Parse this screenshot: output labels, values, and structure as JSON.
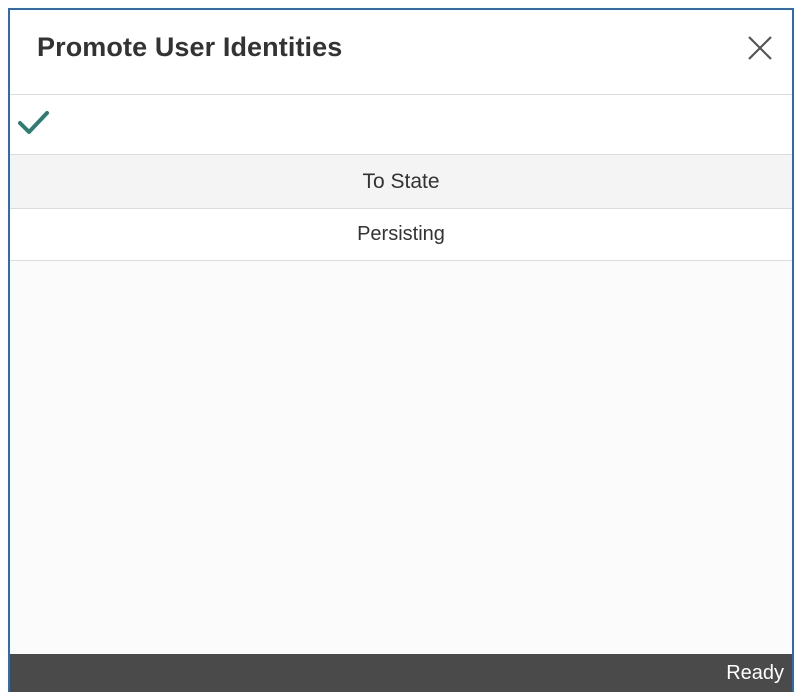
{
  "dialog": {
    "title": "Promote User Identities",
    "close_icon": "close-icon",
    "confirm_icon": "checkmark-icon"
  },
  "table": {
    "columns": [
      "To State"
    ],
    "rows": [
      {
        "to_state": "Persisting"
      }
    ]
  },
  "status": {
    "text": "Ready"
  },
  "colors": {
    "accent_border": "#2b6cb5",
    "checkmark": "#2e7d73",
    "status_bar": "#4a4a4a"
  }
}
